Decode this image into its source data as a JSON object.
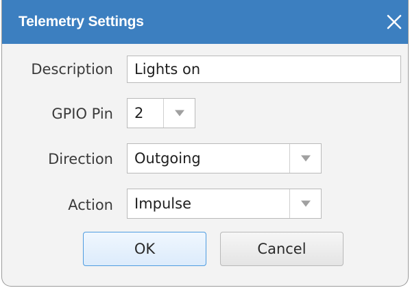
{
  "dialog": {
    "title": "Telemetry Settings",
    "close_icon": "close-icon",
    "colors": {
      "titlebar": "#3c7fc0",
      "background": "#f3f3f3",
      "ok_border": "#4d9be0"
    }
  },
  "form": {
    "description_label": "Description",
    "description_value": "Lights on",
    "gpio_label": "GPIO Pin",
    "gpio_value": "2",
    "direction_label": "Direction",
    "direction_value": "Outgoing",
    "action_label": "Action",
    "action_value": "Impulse",
    "dropdown_icon": "chevron-down-icon"
  },
  "buttons": {
    "ok_label": "OK",
    "cancel_label": "Cancel"
  }
}
